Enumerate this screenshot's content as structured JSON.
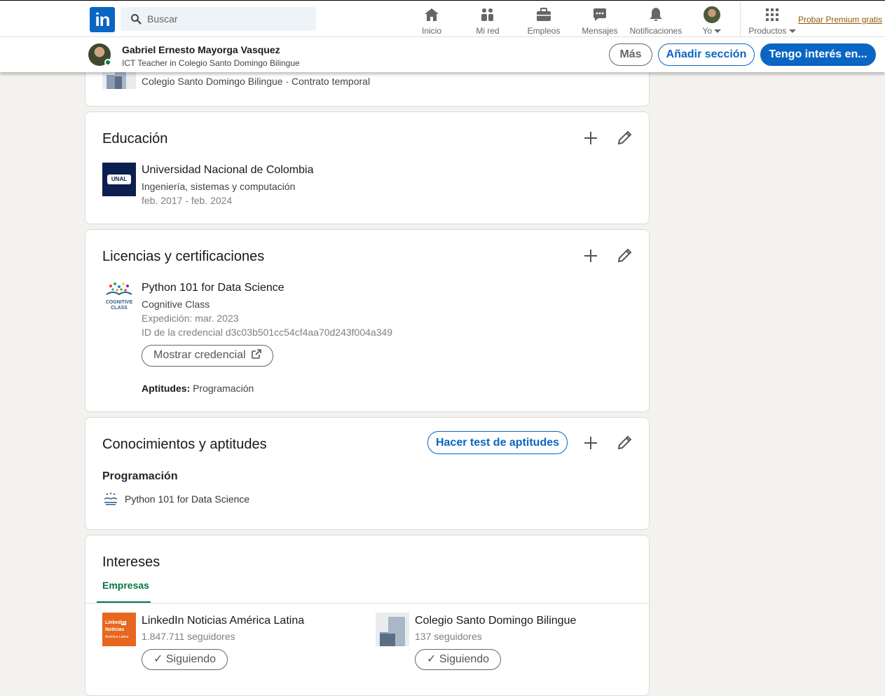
{
  "nav": {
    "search_placeholder": "Buscar",
    "items": [
      {
        "label": "Inicio",
        "icon": "home-icon"
      },
      {
        "label": "Mi red",
        "icon": "network-icon"
      },
      {
        "label": "Empleos",
        "icon": "briefcase-icon"
      },
      {
        "label": "Mensajes",
        "icon": "messaging-icon"
      },
      {
        "label": "Notificaciones",
        "icon": "bell-icon"
      },
      {
        "label": "Yo",
        "icon": "avatar"
      },
      {
        "label": "Productos",
        "icon": "grid-icon"
      }
    ],
    "premium_link": "Probar Premium gratis",
    "logo_text": "in"
  },
  "profile_bar": {
    "name": "Gabriel Ernesto Mayorga Vasquez",
    "headline": "ICT Teacher in Colegio Santo Domingo Bilingue",
    "more_button": "Más",
    "add_section_button": "Añadir sección",
    "open_to_button": "Tengo interés en..."
  },
  "experience_tail": {
    "company_line": "Colegio Santo Domingo Bilingue · Contrato temporal"
  },
  "education": {
    "title": "Educación",
    "school": "Universidad Nacional de Colombia",
    "school_logo_text": "UNAL",
    "degree": "Ingeniería, sistemas y computación",
    "dates": "feb. 2017 - feb. 2024"
  },
  "licenses": {
    "title": "Licencias y certificaciones",
    "cert_name": "Python 101 for Data Science",
    "issuer": "Cognitive Class",
    "issued": "Expedición: mar. 2023",
    "credential_id": "ID de la credencial d3c03b501cc54cf4aa70d243f004a349",
    "show_credential": "Mostrar credencial",
    "skills_label": "Aptitudes:",
    "skills_value": " Programación",
    "issuer_logo_text_1": "COGNITIVE",
    "issuer_logo_text_2": "CLASS"
  },
  "skills": {
    "title": "Conocimientos y aptitudes",
    "test_button": "Hacer test de aptitudes",
    "skill_name": "Programación",
    "skill_source": "Python 101 for Data Science"
  },
  "interests": {
    "title": "Intereses",
    "tab": "Empresas",
    "companies": [
      {
        "name": "LinkedIn Noticias América Latina",
        "followers": "1.847.711 seguidores",
        "button": "Siguiendo",
        "logo_lines": [
          "Linked",
          "Noticias",
          "América Latina"
        ]
      },
      {
        "name": "Colegio Santo Domingo Bilingue",
        "followers": "137 seguidores",
        "button": "Siguiendo"
      }
    ]
  },
  "colors": {
    "brand_blue": "#0a66c2",
    "page_bg": "#f3f2ef",
    "green_tab": "#057642",
    "premium_gold": "#915907"
  }
}
